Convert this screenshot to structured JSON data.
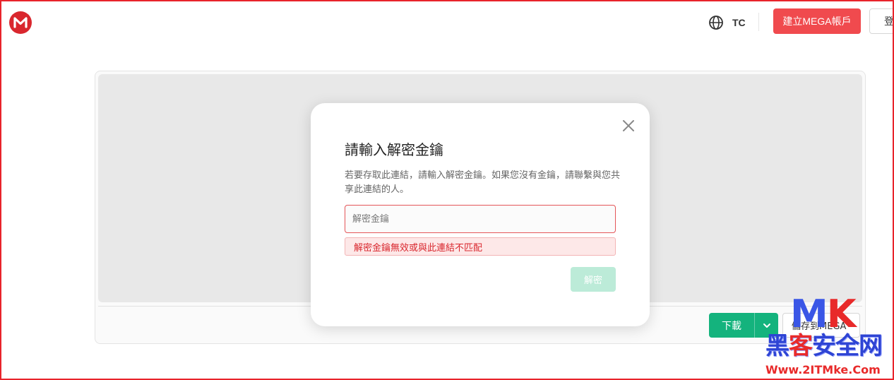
{
  "header": {
    "logo_letter": "M",
    "lang_label": "TC",
    "create_account_label": "建立MEGA帳戶",
    "login_label": "登"
  },
  "modal": {
    "title": "請輸入解密金鑰",
    "description": "若要存取此連結，請輸入解密金鑰。如果您沒有金鑰，請聯繫與您共享此連結的人。",
    "key_input_placeholder": "解密金鑰",
    "key_input_value": "",
    "error_message": "解密金鑰無效或與此連結不匹配",
    "decrypt_label": "解密"
  },
  "actions": {
    "download_label": "下載",
    "save_to_mega_label": "儲存到MEGA"
  },
  "watermark": {
    "brand_m": "M",
    "brand_k": "K",
    "text_part1": "黑",
    "text_part2": "客",
    "text_part3": "安全网",
    "url": "Www.2ITMke.Com"
  },
  "colors": {
    "brand_red": "#d9272e",
    "create_button": "#f04a4e",
    "download_green": "#14b37d",
    "decrypt_disabled": "#bcebd8",
    "error_text": "#d9272e"
  }
}
